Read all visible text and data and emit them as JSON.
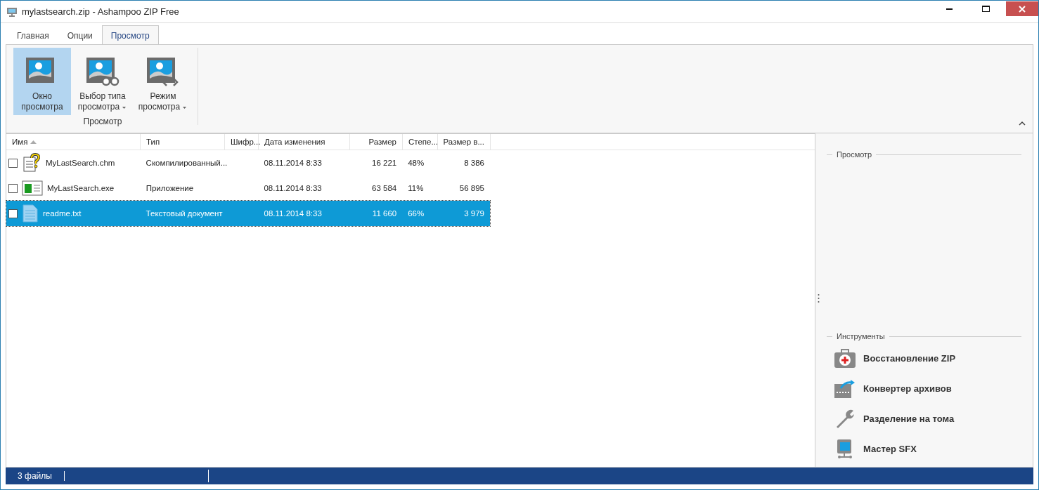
{
  "window": {
    "title": "mylastsearch.zip - Ashampoo ZIP Free"
  },
  "tabs": [
    {
      "label": "Главная",
      "selected": false
    },
    {
      "label": "Опции",
      "selected": false
    },
    {
      "label": "Просмотр",
      "selected": true
    }
  ],
  "ribbon": {
    "group_label": "Просмотр",
    "buttons": [
      {
        "kind": "preview",
        "lines": [
          "Окно",
          "просмотра"
        ],
        "selected": true,
        "dropdown": false
      },
      {
        "kind": "glasses",
        "lines": [
          "Выбор типа",
          "просмотра"
        ],
        "selected": false,
        "dropdown": true
      },
      {
        "kind": "code",
        "lines": [
          "Режим",
          "просмотра"
        ],
        "selected": false,
        "dropdown": true
      }
    ]
  },
  "table": {
    "columns": [
      {
        "label": "Имя",
        "sorted": true
      },
      {
        "label": "Тип",
        "sorted": false
      },
      {
        "label": "Шифр...",
        "sorted": false
      },
      {
        "label": "Дата изменения",
        "sorted": false
      },
      {
        "label": "Размер",
        "sorted": false
      },
      {
        "label": "Степе...",
        "sorted": false
      },
      {
        "label": "Размер в...",
        "sorted": false
      }
    ],
    "rows": [
      {
        "kind": "help",
        "checked": false,
        "selected": false,
        "cells": [
          "MyLastSearch.chm",
          "Скомпилированный...",
          "",
          "08.11.2014 8:33",
          "16 221",
          "48%",
          "8 386"
        ]
      },
      {
        "kind": "app",
        "checked": false,
        "selected": false,
        "cells": [
          "MyLastSearch.exe",
          "Приложение",
          "",
          "08.11.2014 8:33",
          "63 584",
          "11%",
          "56 895"
        ]
      },
      {
        "kind": "text",
        "checked": false,
        "selected": true,
        "cells": [
          "readme.txt",
          "Текстовый документ",
          "",
          "08.11.2014 8:33",
          "11 660",
          "66%",
          "3 979"
        ]
      }
    ]
  },
  "side_panel": {
    "preview_label": "Просмотр",
    "tools_label": "Инструменты",
    "tools": [
      {
        "kind": "repair",
        "label": "Восстановление ZIP"
      },
      {
        "kind": "convert",
        "label": "Конвертер архивов"
      },
      {
        "kind": "split",
        "label": "Разделение на тома"
      },
      {
        "kind": "sfx",
        "label": "Мастер SFX"
      }
    ]
  },
  "status_bar": {
    "text": "3 файлы"
  }
}
